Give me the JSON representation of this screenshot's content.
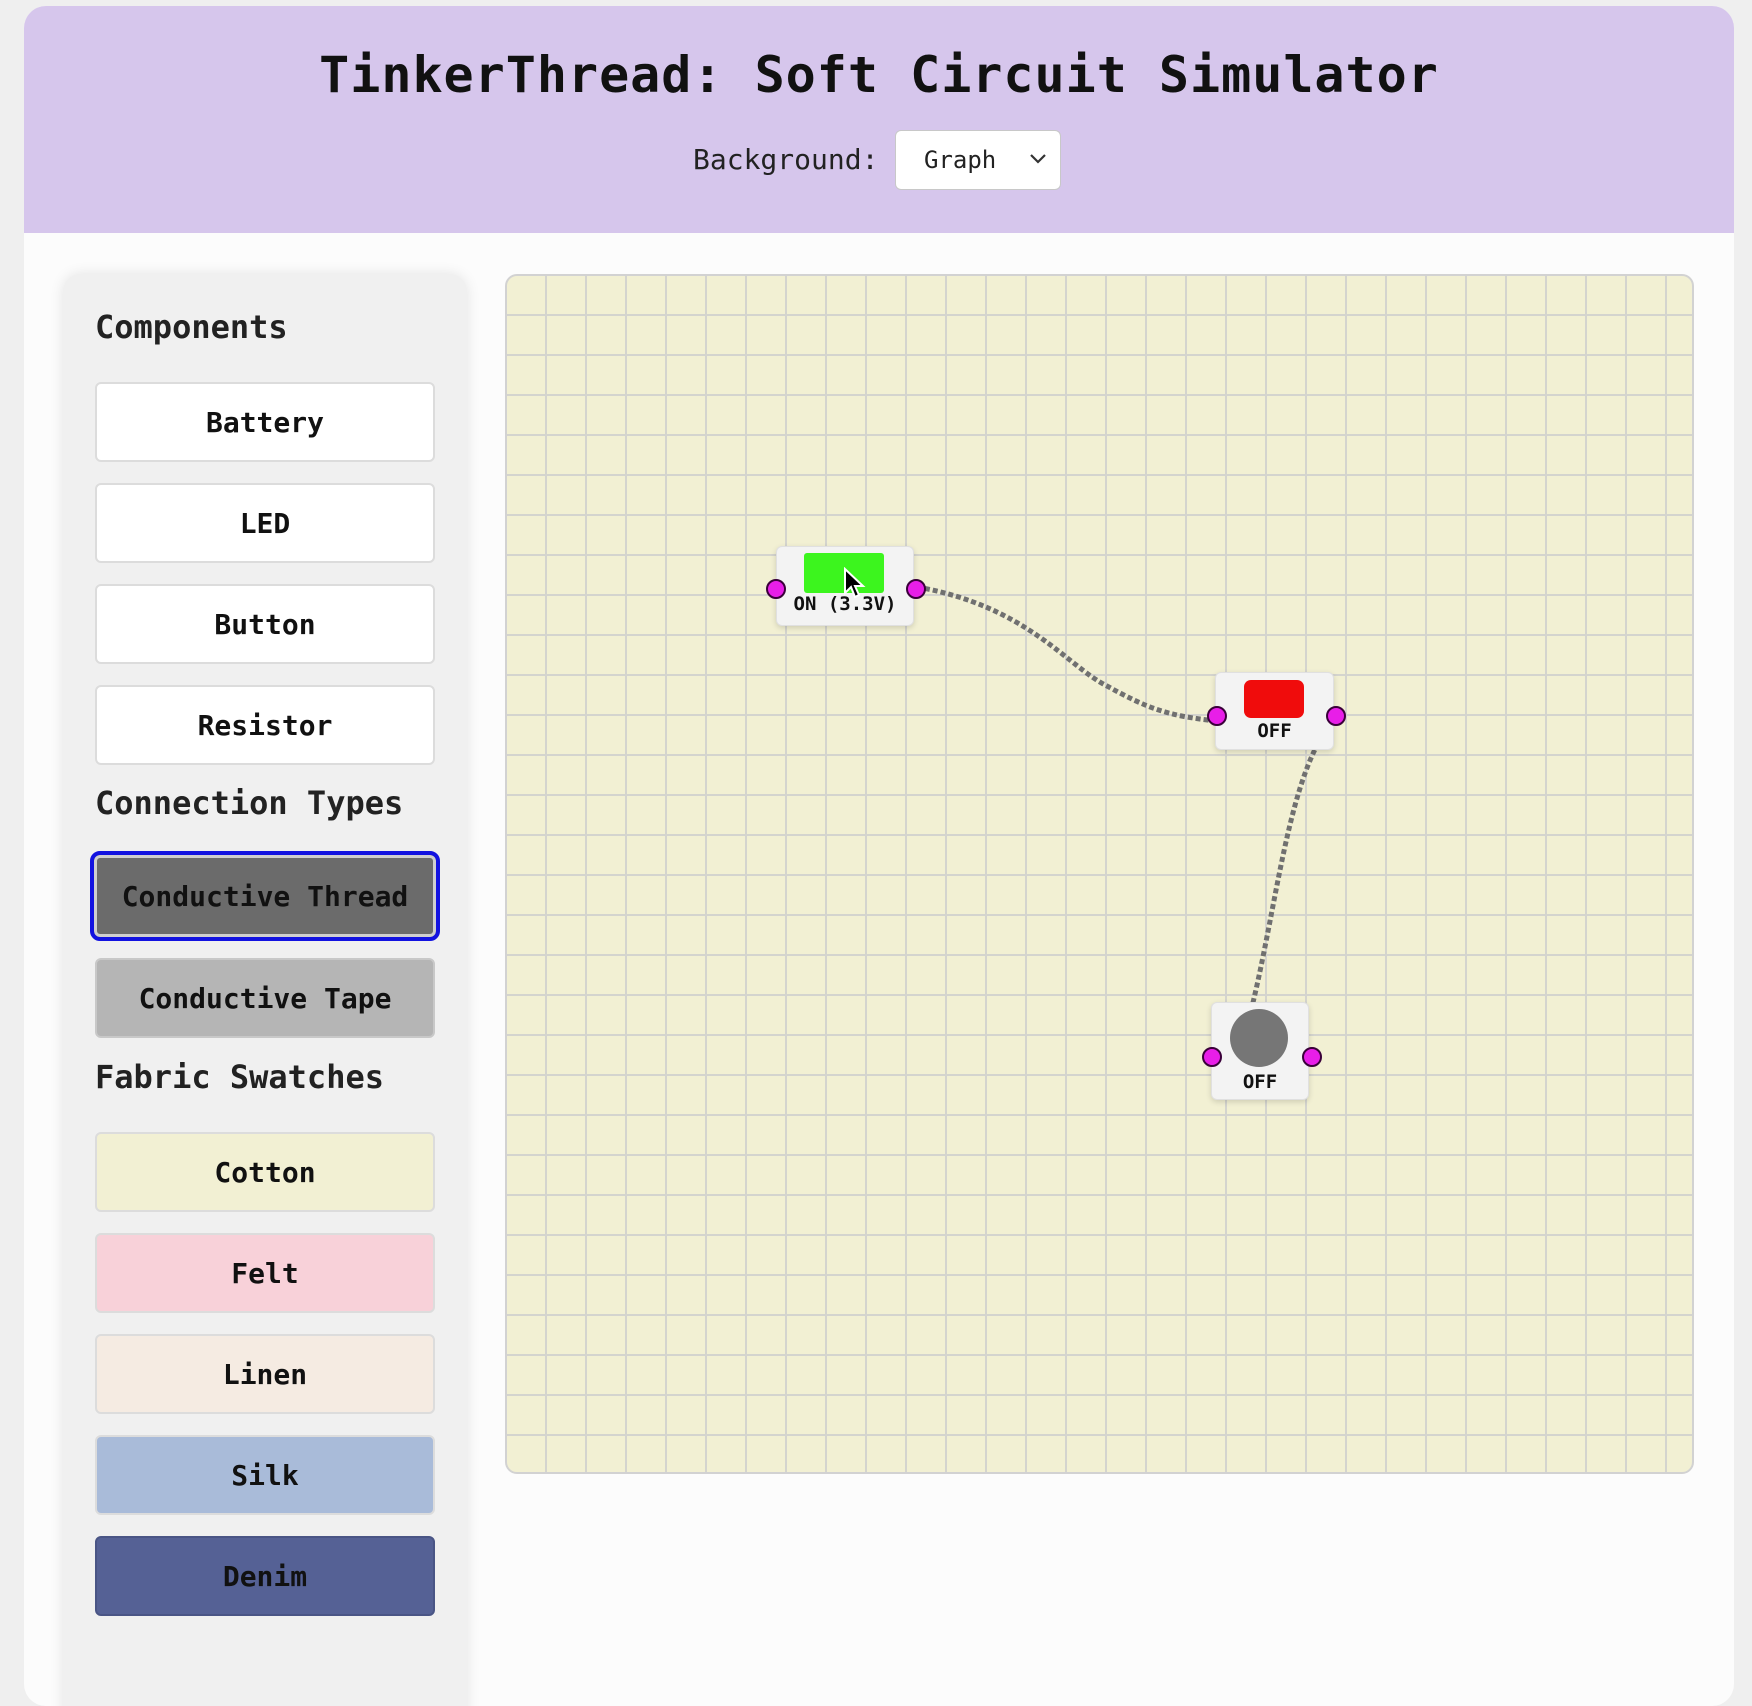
{
  "header": {
    "title": "TinkerThread: Soft Circuit Simulator",
    "background_label": "Background:",
    "background_value": "Graph"
  },
  "sidebar": {
    "components_title": "Components",
    "components": [
      "Battery",
      "LED",
      "Button",
      "Resistor"
    ],
    "connections_title": "Connection Types",
    "connections": [
      "Conductive Thread",
      "Conductive Tape"
    ],
    "selected_connection": "Conductive Thread",
    "fabrics_title": "Fabric Swatches",
    "fabrics": [
      {
        "label": "Cotton",
        "color": "#f2f0d3"
      },
      {
        "label": "Felt",
        "color": "#f8d1d9"
      },
      {
        "label": "Linen",
        "color": "#f5ebe2"
      },
      {
        "label": "Silk",
        "color": "#a9bbd9"
      },
      {
        "label": "Denim",
        "color": "#556195"
      }
    ]
  },
  "canvas": {
    "background": "graph",
    "fabric_color": "#f2f0d3",
    "battery": {
      "status": "ON (3.3V)",
      "color": "#3cf51e"
    },
    "led": {
      "status": "OFF",
      "color": "#f00c0c"
    },
    "button": {
      "status": "OFF",
      "color": "#767676"
    },
    "pin_color": "#e81ee8",
    "wire_type": "Conductive Thread"
  }
}
